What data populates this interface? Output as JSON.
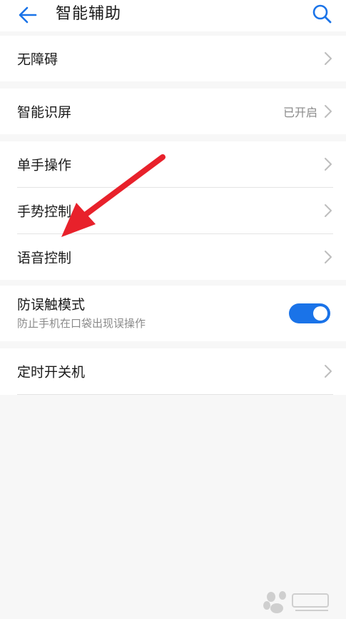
{
  "header": {
    "title": "智能辅助",
    "back_icon": "arrow-left-icon",
    "search_icon": "search-icon"
  },
  "sections": [
    {
      "items": [
        {
          "label": "无障碍"
        }
      ]
    },
    {
      "items": [
        {
          "label": "智能识屏",
          "value": "已开启"
        }
      ]
    },
    {
      "items": [
        {
          "label": "单手操作"
        },
        {
          "label": "手势控制"
        },
        {
          "label": "语音控制"
        }
      ]
    },
    {
      "items": [
        {
          "label": "防误触模式",
          "subtitle": "防止手机在口袋出现误操作",
          "toggle": "on"
        }
      ]
    },
    {
      "items": [
        {
          "label": "定时开关机"
        }
      ]
    }
  ],
  "colors": {
    "accent": "#1a73e8",
    "annotation_arrow": "#e8212b"
  }
}
